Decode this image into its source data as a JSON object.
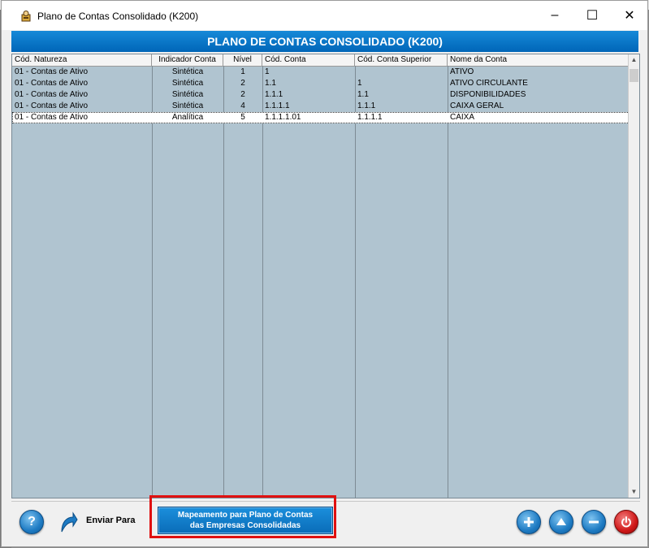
{
  "window": {
    "title": "Plano de Contas Consolidado (K200)",
    "controls": {
      "minimize": "–",
      "maximize": "☐",
      "close": "✕"
    }
  },
  "banner": {
    "title": "PLANO DE CONTAS CONSOLIDADO (K200)"
  },
  "grid": {
    "columns": [
      "Cód. Natureza",
      "Indicador Conta",
      "Nível",
      "Cód. Conta",
      "Cód. Conta Superior",
      "Nome da Conta"
    ],
    "rows": [
      {
        "natureza": "01 - Contas de Ativo",
        "indicador": "Sintética",
        "nivel": "1",
        "cod_conta": "1",
        "cod_superior": "",
        "nome": "ATIVO",
        "selected": false
      },
      {
        "natureza": "01 - Contas de Ativo",
        "indicador": "Sintética",
        "nivel": "2",
        "cod_conta": "1.1",
        "cod_superior": "1",
        "nome": "ATIVO CIRCULANTE",
        "selected": false
      },
      {
        "natureza": "01 - Contas de Ativo",
        "indicador": "Sintética",
        "nivel": "2",
        "cod_conta": "1.1.1",
        "cod_superior": "1.1",
        "nome": "DISPONIBILIDADES",
        "selected": false
      },
      {
        "natureza": "01 - Contas de Ativo",
        "indicador": "Sintética",
        "nivel": "4",
        "cod_conta": "1.1.1.1",
        "cod_superior": "1.1.1",
        "nome": "CAIXA GERAL",
        "selected": false
      },
      {
        "natureza": "01 - Contas de Ativo",
        "indicador": "Analítica",
        "nivel": "5",
        "cod_conta": "1.1.1.1.01",
        "cod_superior": "1.1.1.1",
        "nome": "CAIXA",
        "selected": true
      }
    ]
  },
  "bottombar": {
    "help_icon": "question-icon",
    "send_label": "Enviar Para",
    "map_button_line1": "Mapeamento para Plano de Contas",
    "map_button_line2": "das Empresas Consolidadas",
    "add_icon": "plus-icon",
    "up_icon": "arrow-up-icon",
    "remove_icon": "minus-icon",
    "power_icon": "power-icon"
  },
  "colors": {
    "accent": "#0078d4",
    "grid_bg": "#b0c4d0",
    "highlight": "#e01010",
    "power": "#d01818"
  }
}
